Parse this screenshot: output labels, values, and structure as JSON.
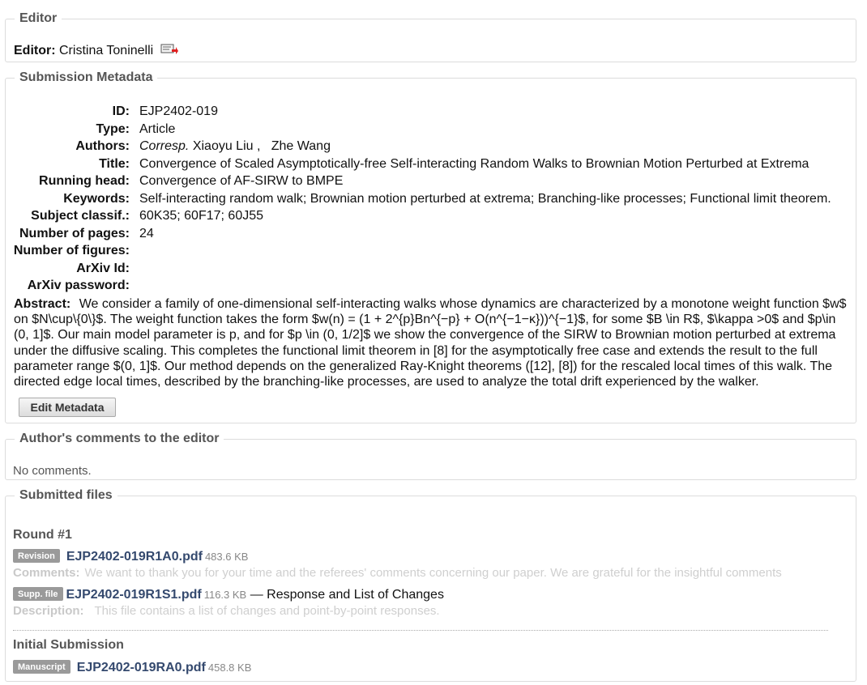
{
  "editor_section": {
    "legend": "Editor",
    "label": "Editor:",
    "name": "Cristina Toninelli",
    "icon": "mail-send-icon"
  },
  "metadata_section": {
    "legend": "Submission Metadata",
    "id_label": "ID:",
    "id_value": "EJP2402-019",
    "type_label": "Type:",
    "type_value": "Article",
    "authors_label": "Authors:",
    "authors_corresp": "Corresp.",
    "authors_value": "Xiaoyu Liu ,   Zhe Wang",
    "title_label": "Title:",
    "title_value": "Convergence of Scaled Asymptotically-free Self-interacting Random Walks to Brownian Motion Perturbed at Extrema",
    "running_head_label": "Running head:",
    "running_head_value": "Convergence of AF-SIRW to BMPE",
    "keywords_label": "Keywords:",
    "keywords_value": "Self-interacting random walk; Brownian motion perturbed at extrema; Branching-like processes; Functional limit theorem.",
    "subject_label": "Subject classif.:",
    "subject_value": "60K35; 60F17; 60J55",
    "pages_label": "Number of pages:",
    "pages_value": "24",
    "figures_label": "Number of figures:",
    "figures_value": "",
    "arxiv_id_label": "ArXiv Id:",
    "arxiv_id_value": "",
    "arxiv_password_label": "ArXiv password:",
    "arxiv_password_value": "",
    "abstract_label": "Abstract:",
    "abstract_text": "We consider a family of one-dimensional self-interacting walks whose dynamics are characterized by a monotone weight function $w$ on $N\\cup\\{0\\}$. The weight function takes the form $w(n) = (1 + 2^{p}Bn^{−p} + O(n^{−1−κ}))^{−1}$, for some $B \\in R$, $\\kappa >0$ and $p\\in (0, 1]$. Our main model parameter is p, and for $p \\in (0, 1/2]$ we show the convergence of the SIRW to Brownian motion perturbed at extrema under the diffusive scaling. This completes the functional limit theorem in [8] for the asymptotically free case and extends the result to the full parameter range $(0, 1]$. Our method depends on the generalized Ray-Knight theorems ([12], [8]) for the rescaled local times of this walk. The directed edge local times, described by the branching-like processes, are used to analyze the total drift experienced by the walker.",
    "edit_button": "Edit Metadata"
  },
  "comments_section": {
    "legend": "Author's comments to the editor",
    "text": "No comments."
  },
  "files_section": {
    "legend": "Submitted files",
    "round1": {
      "heading": "Round #1",
      "revision": {
        "badge": "Revision",
        "filename": "EJP2402-019R1A0.pdf",
        "size": "483.6 KB",
        "comments_label": "Comments:",
        "comments_text": "We want to thank you for your time and the referees' comments concerning our paper. We are grateful for the insightful comments"
      },
      "supp": {
        "badge": "Supp. file",
        "filename": "EJP2402-019R1S1.pdf",
        "size": "116.3 KB",
        "title": "— Response and List of Changes",
        "description_label": "Description:",
        "description_text": "This file contains a list of changes and point-by-point responses."
      }
    },
    "initial": {
      "heading": "Initial Submission",
      "manuscript": {
        "badge": "Manuscript",
        "filename": "EJP2402-019RA0.pdf",
        "size": "458.8 KB"
      }
    }
  }
}
